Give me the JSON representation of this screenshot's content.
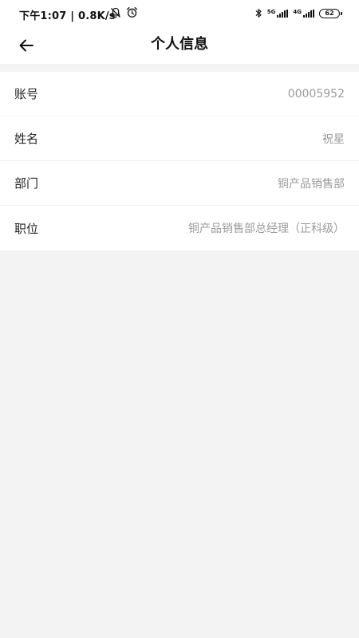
{
  "status_bar": {
    "time": "下午1:07",
    "speed": "0.8K/s",
    "signal_1_label": "5G",
    "signal_2_label": "4G",
    "battery": "62",
    "icons": [
      "mute-bell-icon",
      "alarm-icon",
      "bluetooth-icon",
      "signal-icon",
      "battery-icon"
    ]
  },
  "header": {
    "title": "个人信息",
    "back_icon": "back-arrow-icon"
  },
  "profile": {
    "rows": [
      {
        "label": "账号",
        "value": "00005952"
      },
      {
        "label": "姓名",
        "value": "祝星"
      },
      {
        "label": "部门",
        "value": "铜产品销售部"
      },
      {
        "label": "职位",
        "value": "铜产品销售部总经理（正科级）"
      }
    ]
  }
}
